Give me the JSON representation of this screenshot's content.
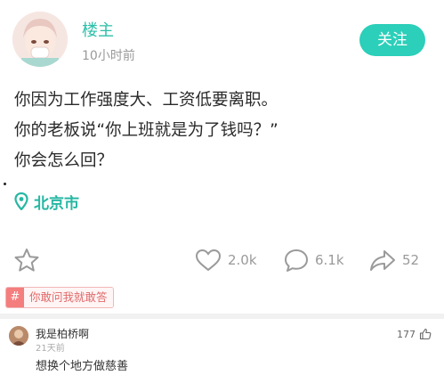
{
  "post": {
    "author_name": "楼主",
    "time": "10小时前",
    "follow_label": "关注",
    "lines": [
      "你因为工作强度大、工资低要离职。",
      "你的老板说“你上班就是为了钱吗？”",
      "你会怎么回？"
    ],
    "location": "北京市",
    "actions": {
      "likes": "2.0k",
      "comments": "6.1k",
      "shares": "52"
    },
    "tag": "你敢问我就敢答"
  },
  "comment": {
    "author": "我是柏桥啊",
    "time": "21天前",
    "text": "想换个地方做慈善",
    "likes": "177"
  },
  "colors": {
    "accent": "#2ccfb9",
    "location": "#27b7a3",
    "tag": "#f47d7d"
  },
  "icons": [
    "avatar",
    "location-pin-icon",
    "star-icon",
    "heart-icon",
    "comment-icon",
    "share-icon",
    "hash-icon",
    "thumbs-up-icon"
  ]
}
